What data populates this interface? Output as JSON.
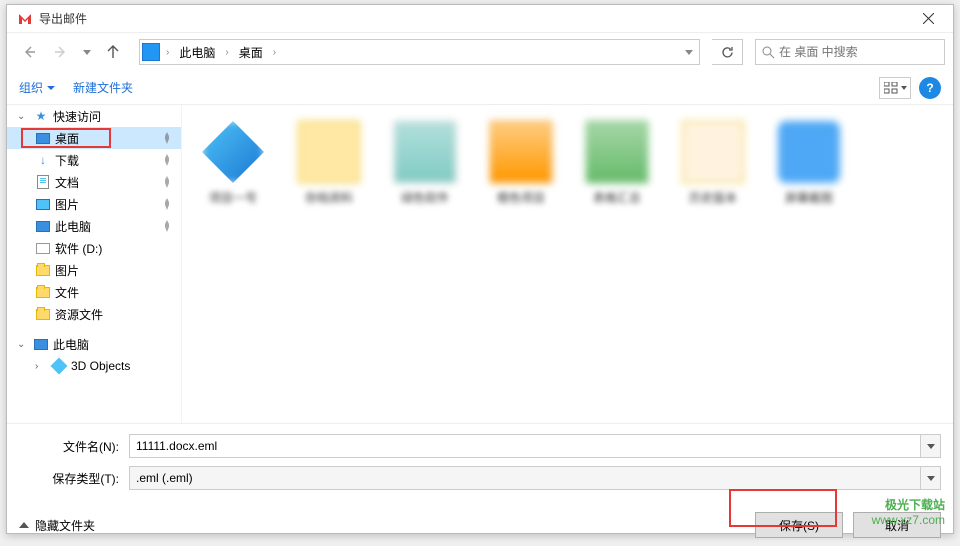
{
  "title": "导出邮件",
  "nav": {
    "path": [
      "此电脑",
      "桌面"
    ],
    "search_placeholder": "在 桌面 中搜索"
  },
  "toolbar": {
    "organize": "组织",
    "new_folder": "新建文件夹"
  },
  "sidebar": {
    "quick_access": "快速访问",
    "items": [
      {
        "label": "桌面",
        "icon": "monitor",
        "pinned": true,
        "selected": true
      },
      {
        "label": "下载",
        "icon": "download",
        "pinned": true
      },
      {
        "label": "文档",
        "icon": "doc",
        "pinned": true
      },
      {
        "label": "图片",
        "icon": "picture",
        "pinned": true
      },
      {
        "label": "此电脑",
        "icon": "pc",
        "pinned": true
      },
      {
        "label": "软件 (D:)",
        "icon": "disk",
        "pinned": false
      },
      {
        "label": "图片",
        "icon": "folder",
        "pinned": false
      },
      {
        "label": "文件",
        "icon": "folder",
        "pinned": false
      },
      {
        "label": "资源文件",
        "icon": "folder",
        "pinned": false
      }
    ],
    "this_pc": "此电脑",
    "objects3d": "3D Objects"
  },
  "files": {
    "items": [
      {
        "label": "项目一号"
      },
      {
        "label": "存档资料"
      },
      {
        "label": "绿色软件"
      },
      {
        "label": "橙色项目"
      },
      {
        "label": "表格汇总"
      },
      {
        "label": "历史版本"
      },
      {
        "label": "屏幕截图"
      }
    ]
  },
  "form": {
    "filename_label": "文件名(N):",
    "filename_value": "11111.docx.eml",
    "filetype_label": "保存类型(T):",
    "filetype_value": ".eml (.eml)"
  },
  "footer": {
    "hide_folders": "隐藏文件夹",
    "save": "保存(S)",
    "cancel": "取消"
  },
  "watermark": {
    "cn": "极光下载站",
    "url": "www.xz7.com"
  }
}
